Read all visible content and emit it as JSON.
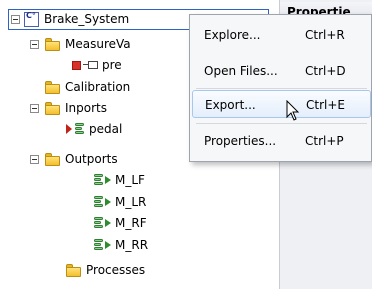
{
  "right_pane": {
    "header": "Propertie"
  },
  "tree": {
    "root": {
      "label": "Brake_System",
      "type_icon": "component-type-icon",
      "badge": "C"
    },
    "items": [
      {
        "label": "MeasureVa",
        "icon": "folder-icon"
      },
      {
        "label": "pre",
        "icon": "measure-variable-icon"
      },
      {
        "label": "Calibration",
        "icon": "folder-icon"
      },
      {
        "label": "Inports",
        "icon": "folder-icon"
      },
      {
        "label": "pedal",
        "icon": "inport-icon"
      },
      {
        "label": "Outports",
        "icon": "folder-icon"
      },
      {
        "label": "M_LF",
        "icon": "outport-icon"
      },
      {
        "label": "M_LR",
        "icon": "outport-icon"
      },
      {
        "label": "M_RF",
        "icon": "outport-icon"
      },
      {
        "label": "M_RR",
        "icon": "outport-icon"
      },
      {
        "label": "Processes",
        "icon": "folder-icon"
      }
    ]
  },
  "context_menu": {
    "items": [
      {
        "label": "Explore...",
        "shortcut": "Ctrl+R"
      },
      {
        "label": "Open Files...",
        "shortcut": "Ctrl+D"
      },
      {
        "label": "Export...",
        "shortcut": "Ctrl+E",
        "highlighted": true
      },
      {
        "label": "Properties...",
        "shortcut": "Ctrl+P"
      }
    ]
  },
  "colors": {
    "selection_border": "#2f62c8",
    "folder": "#f3bf2c",
    "menu_highlight_border": "#a9c7ee"
  }
}
